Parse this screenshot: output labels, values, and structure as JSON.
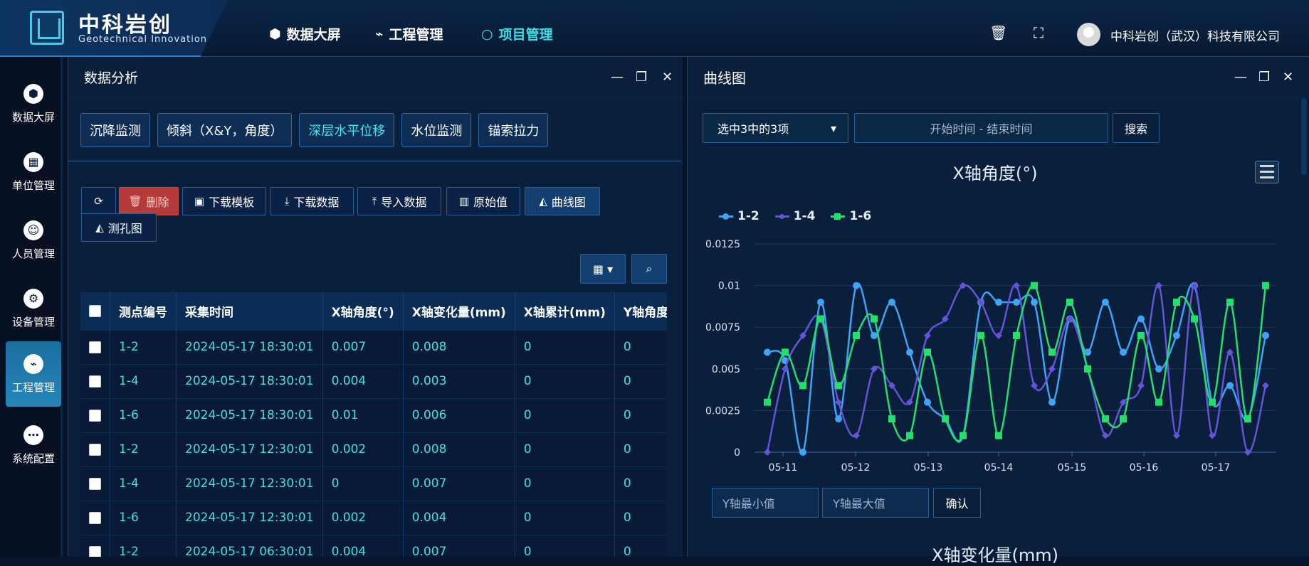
{
  "header": {
    "brand_cn": "中科岩创",
    "brand_en": "Geotechnical Innovation",
    "nav": [
      {
        "label": "数据大屏",
        "icon": "cube-icon"
      },
      {
        "label": "工程管理",
        "icon": "chart-icon"
      },
      {
        "label": "项目管理",
        "icon": "circle-icon"
      }
    ],
    "company": "中科岩创（武汉）科技有限公司"
  },
  "sidebar": {
    "items": [
      {
        "label": "数据大屏",
        "icon": "cube-icon"
      },
      {
        "label": "单位管理",
        "icon": "calendar-icon"
      },
      {
        "label": "人员管理",
        "icon": "person-icon"
      },
      {
        "label": "设备管理",
        "icon": "gear-icon"
      },
      {
        "label": "工程管理",
        "icon": "chart-icon"
      },
      {
        "label": "系统配置",
        "icon": "dots-icon"
      }
    ]
  },
  "left_panel": {
    "title": "数据分析",
    "tabs": [
      "沉降监测",
      "倾斜（X&Y，角度）",
      "深层水平位移",
      "水位监测",
      "锚索拉力"
    ],
    "active_tab": "深层水平位移",
    "toolbar": {
      "refresh": "",
      "delete": "删除",
      "download_template": "下载模板",
      "download_data": "下载数据",
      "import_data": "导入数据",
      "raw_values": "原始值",
      "curve_chart": "曲线图",
      "hole_chart": "测孔图"
    },
    "table": {
      "headers": [
        "测点编号",
        "采集时间",
        "X轴角度(°)",
        "X轴变化量(mm)",
        "X轴累计(mm)",
        "Y轴角度(°)"
      ],
      "rows": [
        [
          "1-2",
          "2024-05-17 18:30:01",
          "0.007",
          "0.008",
          "0",
          "0"
        ],
        [
          "1-4",
          "2024-05-17 18:30:01",
          "0.004",
          "0.003",
          "0",
          "0"
        ],
        [
          "1-6",
          "2024-05-17 18:30:01",
          "0.01",
          "0.006",
          "0",
          "0"
        ],
        [
          "1-2",
          "2024-05-17 12:30:01",
          "0.002",
          "0.008",
          "0",
          "0"
        ],
        [
          "1-4",
          "2024-05-17 12:30:01",
          "0",
          "0.007",
          "0",
          "0"
        ],
        [
          "1-6",
          "2024-05-17 12:30:01",
          "0.002",
          "0.004",
          "0",
          "0"
        ],
        [
          "1-2",
          "2024-05-17 06:30:01",
          "0.004",
          "0.007",
          "0",
          "0"
        ]
      ]
    }
  },
  "right_panel": {
    "title": "曲线图",
    "select_value": "选中3中的3项",
    "date_placeholder": "开始时间 - 结束时间",
    "search_label": "搜索",
    "y_min_placeholder": "Y轴最小值",
    "y_max_placeholder": "Y轴最大值",
    "confirm_label": "确认",
    "next_chart_title": "X轴变化量(mm)"
  },
  "chart_data": {
    "type": "line",
    "title": "X轴角度(°)",
    "x_ticks": [
      "05-11",
      "05-12",
      "05-13",
      "05-14",
      "05-15",
      "05-16",
      "05-17"
    ],
    "y_ticks": [
      "0",
      "0.0025",
      "0.005",
      "0.0075",
      "0.01",
      "0.0125"
    ],
    "ylim": [
      0,
      0.0125
    ],
    "colors": {
      "1-2": "#3ea4f5",
      "1-4": "#6554d8",
      "1-6": "#21e06b"
    },
    "legend_position": "top-left",
    "series": [
      {
        "name": "1-2",
        "marker": "circle",
        "values": [
          0.006,
          0.0055,
          0.0,
          0.009,
          0.002,
          0.01,
          0.007,
          0.009,
          0.006,
          0.003,
          0.002,
          0.001,
          0.009,
          0.009,
          0.009,
          0.009,
          0.003,
          0.008,
          0.006,
          0.009,
          0.006,
          0.008,
          0.005,
          0.007,
          0.01,
          0.003,
          0.004,
          0.002,
          0.007
        ]
      },
      {
        "name": "1-4",
        "marker": "diamond",
        "values": [
          0.0,
          0.005,
          0.007,
          0.008,
          0.003,
          0.001,
          0.005,
          0.004,
          0.003,
          0.007,
          0.008,
          0.01,
          0.009,
          0.007,
          0.01,
          0.004,
          0.005,
          0.008,
          0.005,
          0.001,
          0.003,
          0.004,
          0.01,
          0.001,
          0.01,
          0.001,
          0.006,
          0.0,
          0.004
        ]
      },
      {
        "name": "1-6",
        "marker": "square",
        "values": [
          0.003,
          0.006,
          0.004,
          0.008,
          0.004,
          0.007,
          0.008,
          0.002,
          0.001,
          0.006,
          0.002,
          0.001,
          0.007,
          0.001,
          0.007,
          0.01,
          0.006,
          0.009,
          0.005,
          0.002,
          0.002,
          0.007,
          0.003,
          0.009,
          0.008,
          0.003,
          0.009,
          0.002,
          0.01
        ]
      }
    ]
  }
}
